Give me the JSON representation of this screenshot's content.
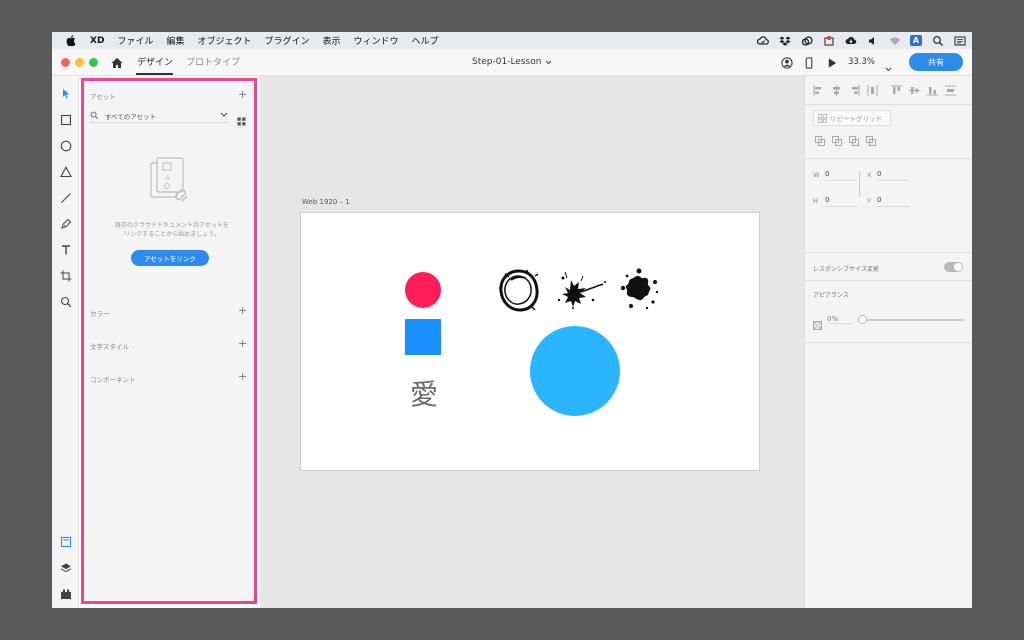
{
  "menubar": {
    "app": "XD",
    "items": [
      "ファイル",
      "編集",
      "オブジェクト",
      "プラグイン",
      "表示",
      "ウィンドウ",
      "ヘルプ"
    ],
    "ime_label": "A"
  },
  "titlebar": {
    "tab_design": "デザイン",
    "tab_prototype": "プロトタイプ",
    "doc_title": "Step-01-Lesson",
    "zoom": "33.3%",
    "share_label": "共有"
  },
  "assets": {
    "title": "アセット",
    "search_placeholder": "すべてのアセット",
    "empty_line1": "既存のクラウドドキュメントのアセットを",
    "empty_line2": "リンクすることから始めましょう。",
    "link_button": "アセットをリンク",
    "sections": [
      "カラー",
      "文字スタイル",
      "コンポーネント"
    ]
  },
  "canvas": {
    "artboard_name": "Web 1920 – 1",
    "kanji": "愛",
    "colors": {
      "pink": "#ff1e5a",
      "blue_square": "#1a8ffe",
      "big_circle": "#2bb5ff"
    }
  },
  "inspector": {
    "repeat_grid": "リピートグリッド",
    "w_label": "W",
    "w_value": "0",
    "x_label": "X",
    "x_value": "0",
    "h_label": "H",
    "h_value": "0",
    "y_label": "Y",
    "y_value": "0",
    "responsive_label": "レスポンシブサイズ変更",
    "appearance_label": "アピアランス",
    "opacity": "0%"
  },
  "theme": {
    "accent": "#2d8ceb",
    "highlight": "#f0448f"
  }
}
